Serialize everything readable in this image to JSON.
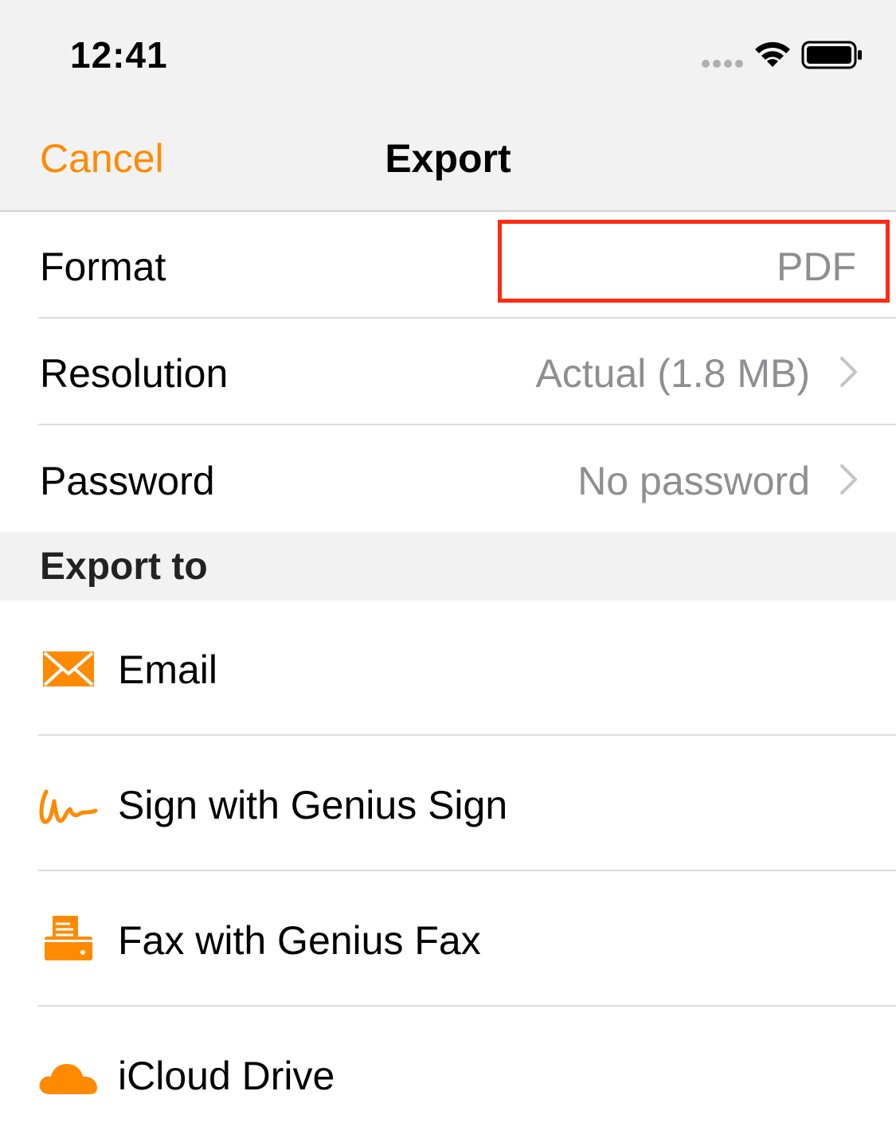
{
  "status": {
    "time": "12:41"
  },
  "nav": {
    "cancel_label": "Cancel",
    "title": "Export"
  },
  "settings": {
    "format": {
      "label": "Format",
      "value": "PDF"
    },
    "resolution": {
      "label": "Resolution",
      "value": "Actual (1.8 MB)"
    },
    "password": {
      "label": "Password",
      "value": "No password"
    }
  },
  "export_to": {
    "header": "Export to",
    "items": [
      {
        "label": "Email",
        "icon": "envelope-icon"
      },
      {
        "label": "Sign with Genius Sign",
        "icon": "signature-icon"
      },
      {
        "label": "Fax with Genius Fax",
        "icon": "fax-icon"
      },
      {
        "label": "iCloud Drive",
        "icon": "cloud-icon"
      }
    ]
  },
  "colors": {
    "accent": "#ff8a00",
    "highlight": "#ff2a10",
    "secondary_text": "#8e8e93",
    "bar_background": "#f2f2f2"
  }
}
